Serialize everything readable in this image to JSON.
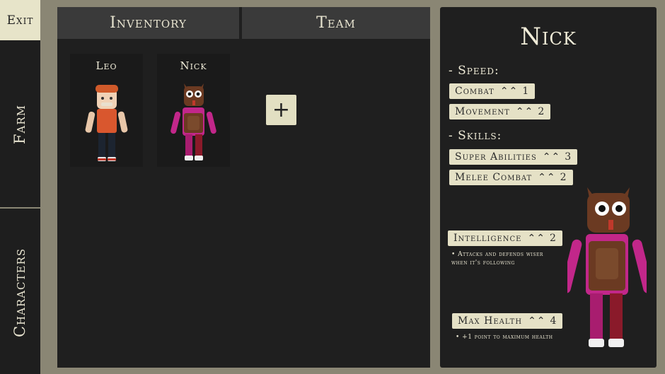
{
  "sidebar": {
    "exit_label": "Exit",
    "farm_label": "Farm",
    "characters_label": "Characters"
  },
  "tabs": {
    "inventory_label": "Inventory",
    "team_label": "Team"
  },
  "team": {
    "members": [
      {
        "name": "Leo"
      },
      {
        "name": "Nick"
      }
    ],
    "add_label": "+"
  },
  "detail": {
    "name": "Nick",
    "speed_heading": "- Speed:",
    "skills_heading": "- Skills:",
    "speed_stats": [
      {
        "label": "Combat",
        "level": "1"
      },
      {
        "label": "Movement",
        "level": "2"
      }
    ],
    "skill_stats": [
      {
        "label": "Super Abilities",
        "level": "3"
      },
      {
        "label": "Melee Combat",
        "level": "2"
      }
    ],
    "intelligence": {
      "label": "Intelligence",
      "level": "2",
      "description_line1": "• Attacks and defends wiser",
      "description_line2": "when it's following"
    },
    "max_health": {
      "label": "Max Health",
      "level": "4",
      "description": "• +1 point to maximum health"
    }
  },
  "icons": {
    "chevron": "double-chevron-up-icon"
  },
  "colors": {
    "background": "#8a8674",
    "panel": "#1f1f1f",
    "chip": "#e5e1c6",
    "tab": "#3a3a3a"
  }
}
